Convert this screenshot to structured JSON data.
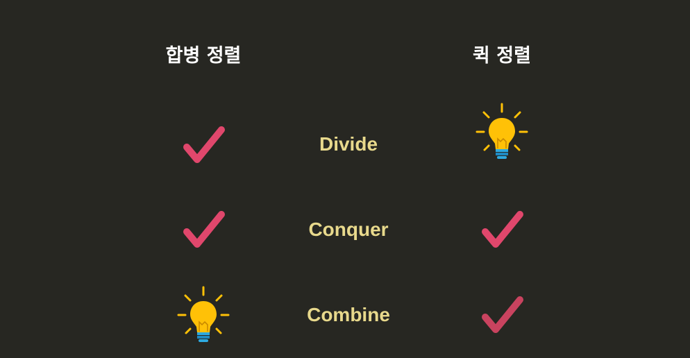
{
  "headings": {
    "merge_sort": "합병 정렬",
    "quick_sort": "퀵 정렬"
  },
  "steps": [
    "Divide",
    "Conquer",
    "Combine"
  ],
  "marks": {
    "merge_sort": [
      "check-icon",
      "check-icon",
      "lightbulb-icon"
    ],
    "quick_sort": [
      "lightbulb-icon",
      "check-icon",
      "check-icon"
    ]
  },
  "colors": {
    "background": "#272722",
    "heading": "#ffffff",
    "step_text": "#e8d98c",
    "check": "#e0476c",
    "bulb": "#ffc107",
    "bulb_base": "#2ea9e0"
  }
}
